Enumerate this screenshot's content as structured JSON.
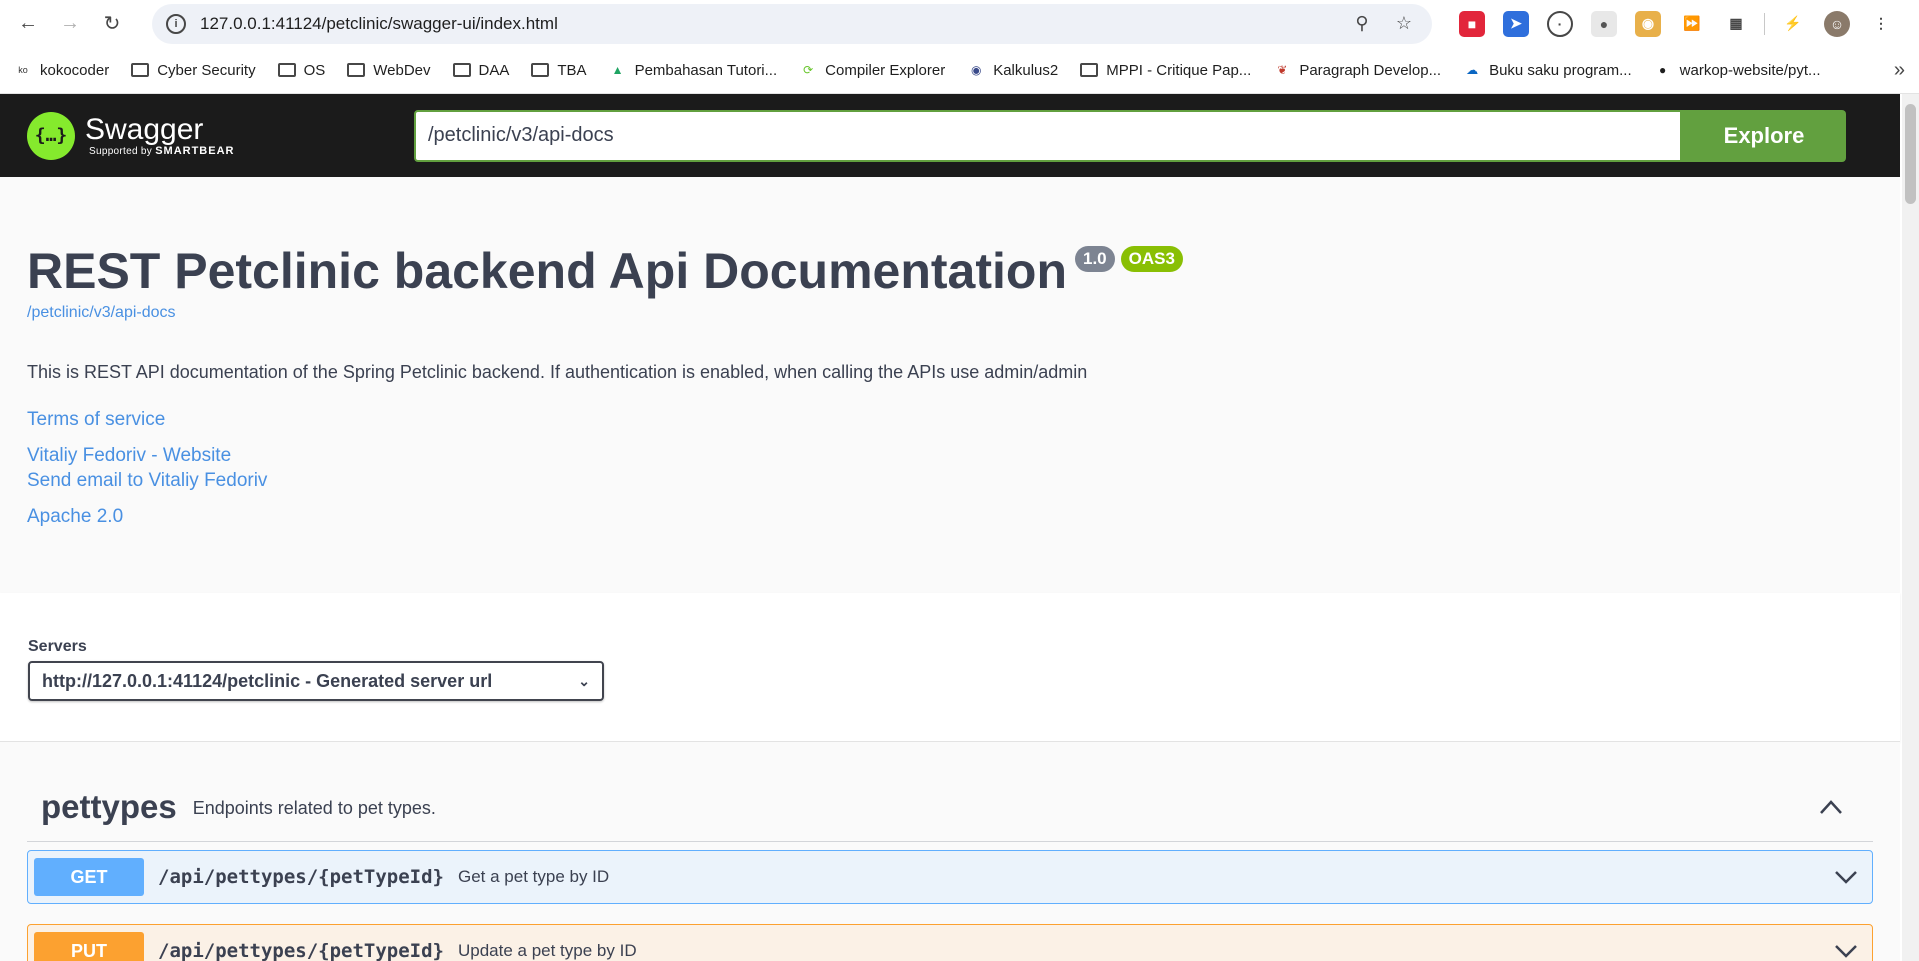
{
  "browser": {
    "url": "127.0.0.1:41124/petclinic/swagger-ui/index.html",
    "bookmarks": [
      {
        "label": "kokocoder",
        "icon": "koko-icon"
      },
      {
        "label": "Cyber Security",
        "icon": "folder-icon"
      },
      {
        "label": "OS",
        "icon": "folder-icon"
      },
      {
        "label": "WebDev",
        "icon": "folder-icon"
      },
      {
        "label": "DAA",
        "icon": "folder-icon"
      },
      {
        "label": "TBA",
        "icon": "folder-icon"
      },
      {
        "label": "Pembahasan Tutori...",
        "icon": "drive-icon"
      },
      {
        "label": "Compiler Explorer",
        "icon": "compiler-explorer-icon"
      },
      {
        "label": "Kalkulus2",
        "icon": "globe-icon"
      },
      {
        "label": "MPPI - Critique Pap...",
        "icon": "folder-icon"
      },
      {
        "label": "Paragraph Develop...",
        "icon": "leaf-icon"
      },
      {
        "label": "Buku saku program...",
        "icon": "cloud-icon"
      },
      {
        "label": "warkop-website/pyt...",
        "icon": "github-icon"
      }
    ]
  },
  "swagger": {
    "brand": "Swagger",
    "brand_sub_prefix": "Supported by",
    "brand_sub_company": "SMARTBEAR",
    "explore_value": "/petclinic/v3/api-docs",
    "explore_label": "Explore"
  },
  "info": {
    "title": "REST Petclinic backend Api Documentation",
    "version": "1.0",
    "oas": "OAS3",
    "docs_url": "/petclinic/v3/api-docs",
    "description": "This is REST API documentation of the Spring Petclinic backend. If authentication is enabled, when calling the APIs use admin/admin",
    "terms": "Terms of service",
    "contact_website": "Vitaliy Fedoriv - Website",
    "contact_email": "Send email to Vitaliy Fedoriv",
    "license": "Apache 2.0"
  },
  "servers": {
    "label": "Servers",
    "selected": "http://127.0.0.1:41124/petclinic - Generated server url"
  },
  "tag": {
    "name": "pettypes",
    "description": "Endpoints related to pet types."
  },
  "operations": [
    {
      "method": "GET",
      "path": "/api/pettypes/{petTypeId}",
      "summary": "Get a pet type by ID"
    },
    {
      "method": "PUT",
      "path": "/api/pettypes/{petTypeId}",
      "summary": "Update a pet type by ID"
    }
  ],
  "colors": {
    "get": "#61affe",
    "put": "#fca130",
    "explore": "#62a03f",
    "link": "#4990e2",
    "oas_badge": "#89bf04"
  }
}
